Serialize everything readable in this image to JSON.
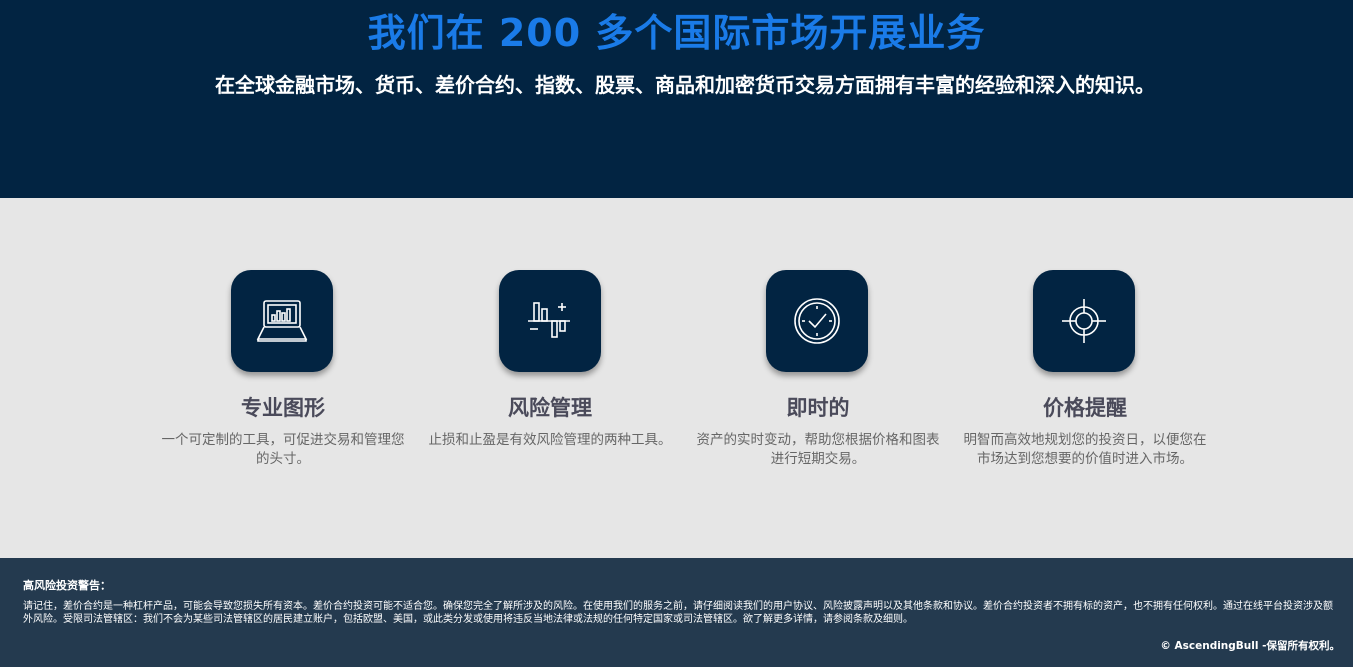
{
  "hero": {
    "title": "我们在 200 多个国际市场开展业务",
    "subtitle": "在全球金融市场、货币、差价合约、指数、股票、商品和加密货币交易方面拥有丰富的经验和深入的知识。"
  },
  "features": [
    {
      "icon": "laptop-chart-icon",
      "title": "专业图形",
      "description": "一个可定制的工具，可促进交易和管理您的头寸。"
    },
    {
      "icon": "risk-bars-icon",
      "title": "风险管理",
      "description": "止损和止盈是有效风险管理的两种工具。"
    },
    {
      "icon": "clock-icon",
      "title": "即时的",
      "description": "资产的实时变动，帮助您根据价格和图表进行短期交易。"
    },
    {
      "icon": "crosshair-icon",
      "title": "价格提醒",
      "description": "明智而高效地规划您的投资日，以便您在市场达到您想要的价值时进入市场。"
    }
  ],
  "footer": {
    "warning_title": "高风险投资警告：",
    "warning_text": "请记住，差价合约是一种杠杆产品，可能会导致您损失所有资本。差价合约投资可能不适合您。确保您完全了解所涉及的风险。在使用我们的服务之前，请仔细阅读我们的用户协议、风险披露声明以及其他条款和协议。差价合约投资者不拥有标的资产，也不拥有任何权利。通过在线平台投资涉及额外风险。受限司法管辖区：我们不会为某些司法管辖区的居民建立账户，包括欧盟、美国，或此类分发或使用将违反当地法律或法规的任何特定国家或司法管辖区。欲了解更多详情，请参阅条款及细则。",
    "copyright": "© AscendingBull -保留所有权利。"
  },
  "colors": {
    "hero_bg": "#022442",
    "title_blue": "#1a7be8",
    "section_bg": "#e6e6e6",
    "footer_bg": "#243a4f"
  }
}
